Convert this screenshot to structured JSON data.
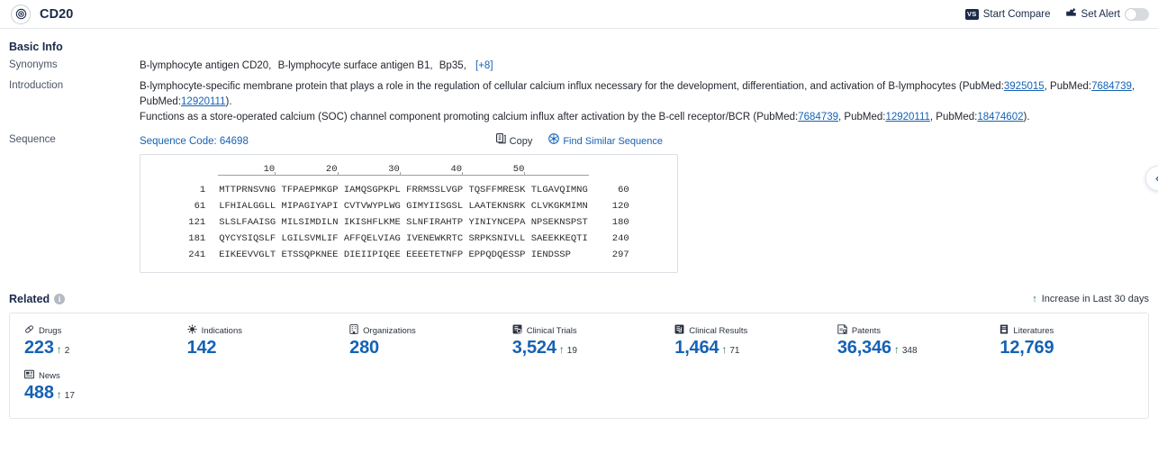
{
  "header": {
    "entity_icon": "target-icon",
    "title": "CD20",
    "start_compare_label": "Start Compare",
    "start_compare_icon": "vs-icon",
    "set_alert_label": "Set Alert",
    "set_alert_icon": "alert-bell-icon",
    "alert_toggle_on": false
  },
  "basic_info": {
    "section_title": "Basic Info",
    "synonyms_label": "Synonyms",
    "synonyms": [
      "B-lymphocyte antigen CD20,",
      "B-lymphocyte surface antigen B1,",
      "Bp35,"
    ],
    "synonyms_more": "[+8]",
    "introduction_label": "Introduction",
    "introduction": {
      "line1_a": "B-lymphocyte-specific membrane protein that plays a role in the regulation of cellular calcium influx necessary for the development, differentiation, and activation of B-lymphocytes (PubMed:",
      "line1_ref1": "3925015",
      "line1_b": ", PubMed:",
      "line1_ref2": "7684739",
      "line1_c": ", PubMed:",
      "line1_ref3": "12920111",
      "line1_d": ").",
      "line2_a": "Functions as a store-operated calcium (SOC) channel component promoting calcium influx after activation by the B-cell receptor/BCR (PubMed:",
      "line2_ref1": "7684739",
      "line2_b": ", PubMed:",
      "line2_ref2": "12920111",
      "line2_c": ", PubMed:",
      "line2_ref3": "18474602",
      "line2_d": ")."
    }
  },
  "sequence": {
    "label": "Sequence",
    "code_label": "Sequence Code: 64698",
    "copy_label": "Copy",
    "copy_icon": "copy-icon",
    "find_similar_label": "Find Similar Sequence",
    "find_similar_icon": "find-similar-icon",
    "ruler": [
      "10",
      "20",
      "30",
      "40",
      "50"
    ],
    "rows": [
      {
        "start": "1",
        "chunks": "MTTPRNSVNG TFPAEPMKGP IAMQSGPKPL FRRMSSLVGP TQSFFMRESK TLGAVQIMNG",
        "end": "60"
      },
      {
        "start": "61",
        "chunks": "LFHIALGGLL MIPAGIYAPI CVTVWYPLWG GIMYIISGSL LAATEKNSRK CLVKGKMIMN",
        "end": "120"
      },
      {
        "start": "121",
        "chunks": "SLSLFAAISG MILSIMDILN IKISHFLKME SLNFIRAHTP YINIYNCEPA NPSEKNSPST",
        "end": "180"
      },
      {
        "start": "181",
        "chunks": "QYCYSIQSLF LGILSVMLIF AFFQELVIAG IVENEWKRTC SRPKSNIVLL SAEEKKEQTI",
        "end": "240"
      },
      {
        "start": "241",
        "chunks": "EIKEEVVGLT ETSSQPKNEE DIEIIPIQEE EEEETETNFP EPPQDQESSP IENDSSP",
        "end": "297"
      }
    ]
  },
  "related": {
    "title": "Related",
    "info_icon": "info-icon",
    "legend_arrow": "↑",
    "legend_label": "Increase in Last 30 days",
    "stats": [
      {
        "icon": "pill-icon",
        "label": "Drugs",
        "value": "223",
        "delta": "2"
      },
      {
        "icon": "virus-icon",
        "label": "Indications",
        "value": "142",
        "delta": ""
      },
      {
        "icon": "building-icon",
        "label": "Organizations",
        "value": "280",
        "delta": ""
      },
      {
        "icon": "clinical-trial-icon",
        "label": "Clinical Trials",
        "value": "3,524",
        "delta": "19"
      },
      {
        "icon": "clinical-result-icon",
        "label": "Clinical Results",
        "value": "1,464",
        "delta": "71"
      },
      {
        "icon": "patent-icon",
        "label": "Patents",
        "value": "36,346",
        "delta": "348"
      },
      {
        "icon": "literature-icon",
        "label": "Literatures",
        "value": "12,769",
        "delta": ""
      },
      {
        "icon": "news-icon",
        "label": "News",
        "value": "488",
        "delta": "17"
      }
    ]
  },
  "edge_fab": {
    "icon": "chevron-left-icon"
  }
}
